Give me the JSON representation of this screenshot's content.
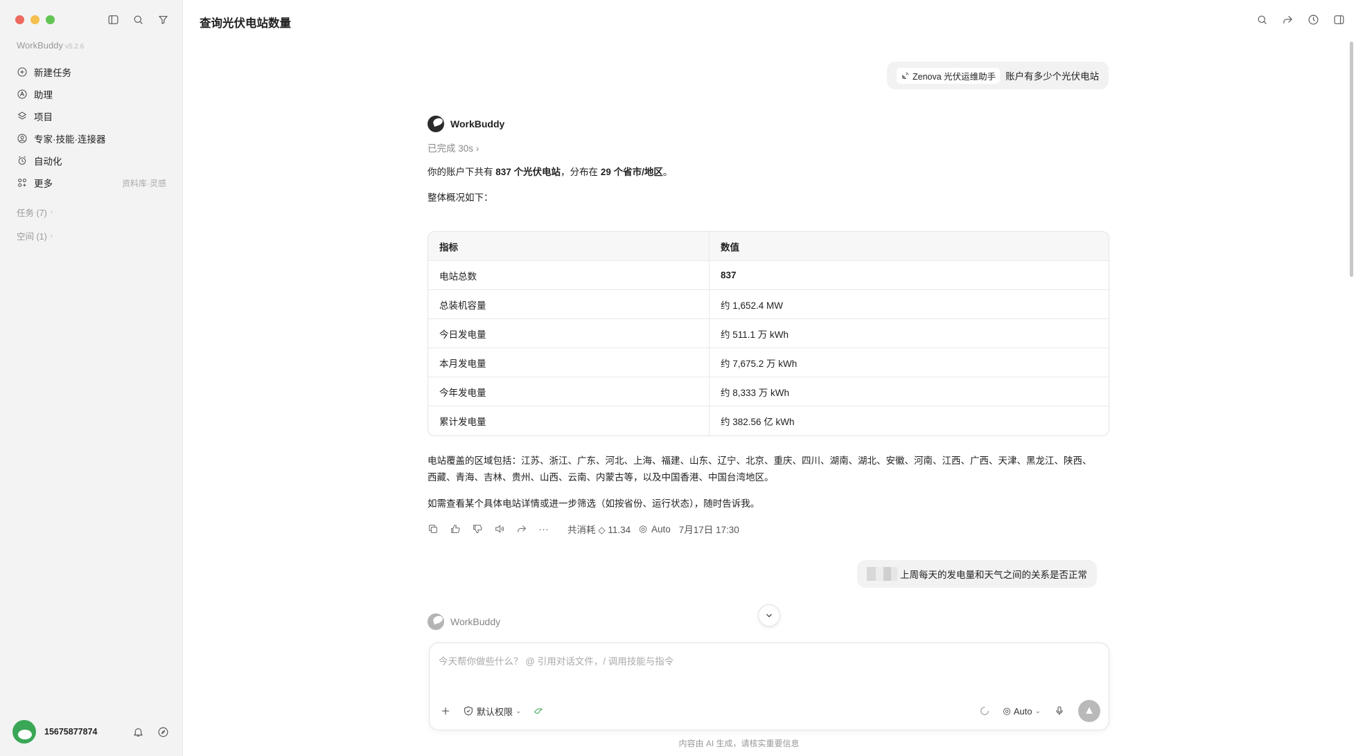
{
  "sidebar": {
    "traffic_colors": [
      "#ed6a5e",
      "#f5bf4f",
      "#61c554"
    ],
    "brand": "WorkBuddy",
    "version": "v5.2.6",
    "items": [
      {
        "label": "新建任务",
        "icon": "plus-circle-icon"
      },
      {
        "label": "助理",
        "icon": "assistant-icon"
      },
      {
        "label": "项目",
        "icon": "project-icon"
      },
      {
        "label": "专家·技能·连接器",
        "icon": "expert-icon"
      },
      {
        "label": "自动化",
        "icon": "alarm-clock-icon"
      },
      {
        "label": "更多",
        "icon": "grid-icon",
        "extra": "资料库·灵感"
      }
    ],
    "tasks": "任务 (7)",
    "spaces": "空间 (1)",
    "user": {
      "phone": "15675877874"
    }
  },
  "header": {
    "title": "查询光伏电站数量"
  },
  "conversation": {
    "user_msg_1": {
      "chip": "Zenova 光伏运维助手",
      "text": "账户有多少个光伏电站"
    },
    "bot_name": "WorkBuddy",
    "status": "已完成 30s",
    "summary_a": "你的账户下共有 ",
    "summary_b": "837 个光伏电站",
    "summary_c": "，分布在 ",
    "summary_d": "29 个省市/地区",
    "summary_e": "。",
    "overview": "整体概况如下：",
    "table": {
      "headers": [
        "指标",
        "数值"
      ],
      "rows": [
        [
          "电站总数",
          "837"
        ],
        [
          "总装机容量",
          "约 1,652.4 MW"
        ],
        [
          "今日发电量",
          "约 511.1 万 kWh"
        ],
        [
          "本月发电量",
          "约 7,675.2 万 kWh"
        ],
        [
          "今年发电量",
          "约 8,333 万 kWh"
        ],
        [
          "累计发电量",
          "约 382.56 亿 kWh"
        ]
      ]
    },
    "regions": "电站覆盖的区域包括：江苏、浙江、广东、河北、上海、福建、山东、辽宁、北京、重庆、四川、湖南、湖北、安徽、河南、江西、广西、天津、黑龙江、陕西、西藏、青海、吉林、贵州、山西、云南、内蒙古等，以及中国香港、中国台湾地区。",
    "followup": "如需查看某个具体电站详情或进一步筛选（如按省份、运行状态），随时告诉我。",
    "meta": {
      "cost": "共消耗 ◇ 11.34",
      "model": "Auto",
      "time": "7月17日 17:30"
    },
    "user_msg_2": {
      "text": "上周每天的发电量和天气之间的关系是否正常"
    },
    "bot_name_2": "WorkBuddy"
  },
  "composer": {
    "placeholder": "今天帮你做些什么？ @ 引用对话文件，/ 调用技能与指令",
    "permission": "默认权限",
    "model": "Auto"
  },
  "footer": "内容由 AI 生成，请核实重要信息"
}
